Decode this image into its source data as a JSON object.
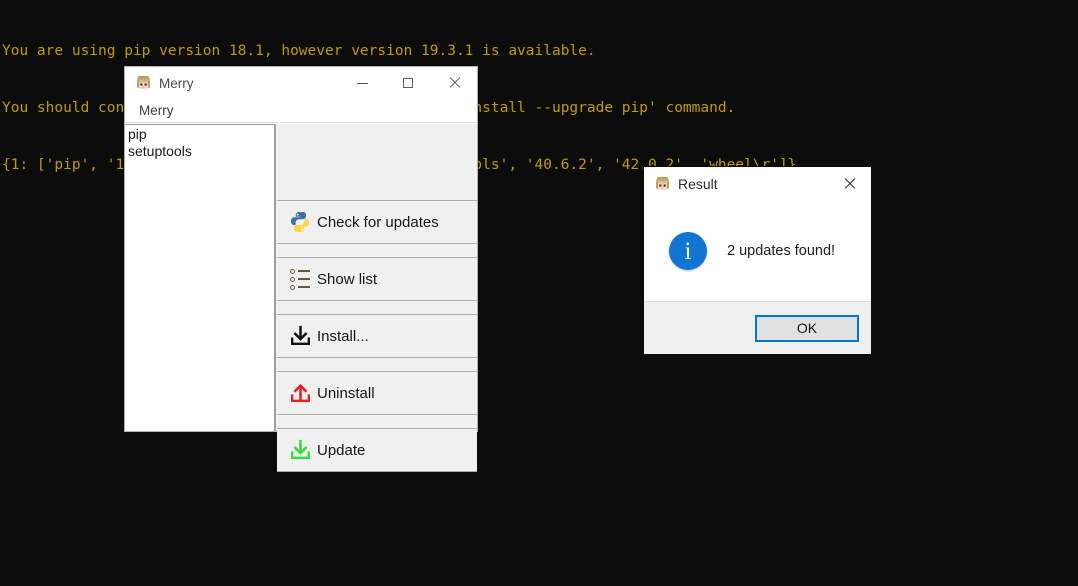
{
  "terminal": {
    "lines": [
      "You are using pip version 18.1, however version 19.3.1 is available.",
      "You should consider upgrading via the 'python -m pip install --upgrade pip' command.",
      "{1: ['pip', '18.1', '19.3.1', 'wheel\\r'], 2: ['setuptools', '40.6.2', '42.0.2', 'wheel\\r']}"
    ],
    "text_color": "#c19c00",
    "background_color": "#0c0c0c"
  },
  "main_window": {
    "title": "Merry",
    "title_icon": "character-face-icon",
    "controls": {
      "minimize": "minimize-icon",
      "maximize": "maximize-icon",
      "close": "close-icon"
    },
    "menubar": {
      "items": [
        {
          "label": "Merry"
        }
      ]
    },
    "package_list": {
      "items": [
        {
          "label": "pip"
        },
        {
          "label": "setuptools"
        }
      ]
    },
    "buttons": [
      {
        "label": "Check for updates",
        "icon": "python-logo-icon"
      },
      {
        "label": "Show list",
        "icon": "list-icon"
      },
      {
        "label": "Install...",
        "icon": "download-arrow-icon"
      },
      {
        "label": "Uninstall",
        "icon": "upload-arrow-red-icon"
      },
      {
        "label": "Update",
        "icon": "download-arrow-green-icon"
      }
    ]
  },
  "result_dialog": {
    "title": "Result",
    "title_icon": "character-face-icon",
    "close_label": "close-icon",
    "icon": "info-icon",
    "info_glyph": "i",
    "message": "2 updates found!",
    "ok_label": "OK",
    "accent_color": "#0078d7",
    "info_color": "#1175d1"
  }
}
